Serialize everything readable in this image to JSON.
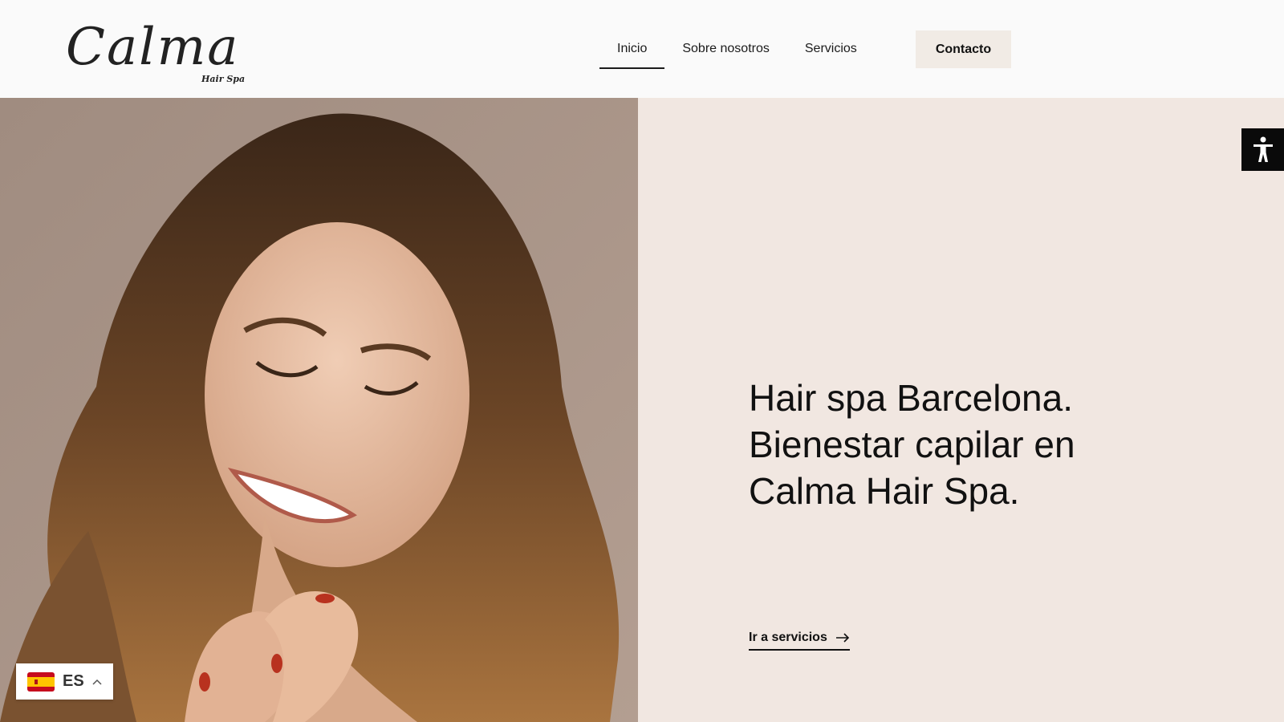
{
  "brand": {
    "logo_text": "Calma",
    "logo_subtext": "Hair Spa"
  },
  "nav": {
    "items": [
      {
        "label": "Inicio",
        "active": true
      },
      {
        "label": "Sobre nosotros",
        "active": false
      },
      {
        "label": "Servicios",
        "active": false
      }
    ],
    "contact_label": "Contacto"
  },
  "hero": {
    "title_lines": [
      "Hair spa Barcelona.",
      "Bienestar capilar en",
      "Calma Hair Spa."
    ],
    "cta_label": "Ir a servicios"
  },
  "language": {
    "code": "ES"
  },
  "icons": {
    "accessibility": "accessibility-icon",
    "arrow": "arrow-right-icon",
    "flag": "spain-flag-icon",
    "chevron": "chevron-up-icon"
  },
  "colors": {
    "header_bg": "#fafafa",
    "panel_bg": "#f1e7e1",
    "contact_bg": "#f1ebe5",
    "text": "#111111",
    "accessibility_bg": "#0a0a0a"
  }
}
